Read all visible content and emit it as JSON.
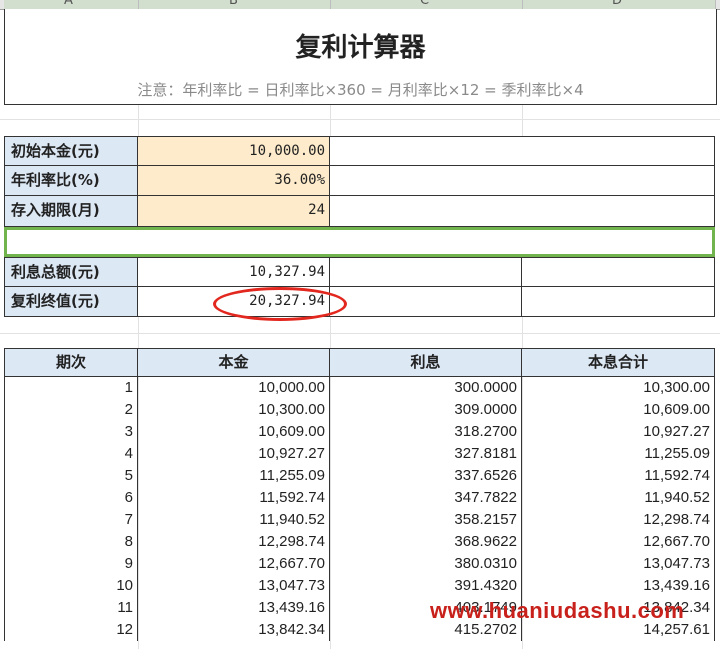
{
  "column_headers": [
    "A",
    "B",
    "C",
    "D"
  ],
  "title": "复利计算器",
  "note": "注意：年利率比 = 日利率比×360 = 月利率比×12 = 季利率比×4",
  "params": [
    {
      "label": "初始本金(元)",
      "value": "10,000.00"
    },
    {
      "label": "年利率比(%)",
      "value": "36.00%"
    },
    {
      "label": "存入期限(月)",
      "value": "24"
    }
  ],
  "results": [
    {
      "label": "利息总额(元)",
      "value": "10,327.94"
    },
    {
      "label": "复利终值(元)",
      "value": "20,327.94"
    }
  ],
  "table": {
    "headers": [
      "期次",
      "本金",
      "利息",
      "本息合计"
    ],
    "rows": [
      [
        "1",
        "10,000.00",
        "300.0000",
        "10,300.00"
      ],
      [
        "2",
        "10,300.00",
        "309.0000",
        "10,609.00"
      ],
      [
        "3",
        "10,609.00",
        "318.2700",
        "10,927.27"
      ],
      [
        "4",
        "10,927.27",
        "327.8181",
        "11,255.09"
      ],
      [
        "5",
        "11,255.09",
        "337.6526",
        "11,592.74"
      ],
      [
        "6",
        "11,592.74",
        "347.7822",
        "11,940.52"
      ],
      [
        "7",
        "11,940.52",
        "358.2157",
        "12,298.74"
      ],
      [
        "8",
        "12,298.74",
        "368.9622",
        "12,667.70"
      ],
      [
        "9",
        "12,667.70",
        "380.0310",
        "13,047.73"
      ],
      [
        "10",
        "13,047.73",
        "391.4320",
        "13,439.16"
      ],
      [
        "11",
        "13,439.16",
        "403.1749",
        "13,842.34"
      ],
      [
        "12",
        "13,842.34",
        "415.2702",
        "14,257.61"
      ]
    ]
  },
  "watermark": "www.huaniudashu.com",
  "colors": {
    "label_bg": "#dde8f5",
    "input_bg": "#fdebcb",
    "selection_border": "#71b44e",
    "circle": "#e2271e",
    "watermark": "#c8201a"
  }
}
